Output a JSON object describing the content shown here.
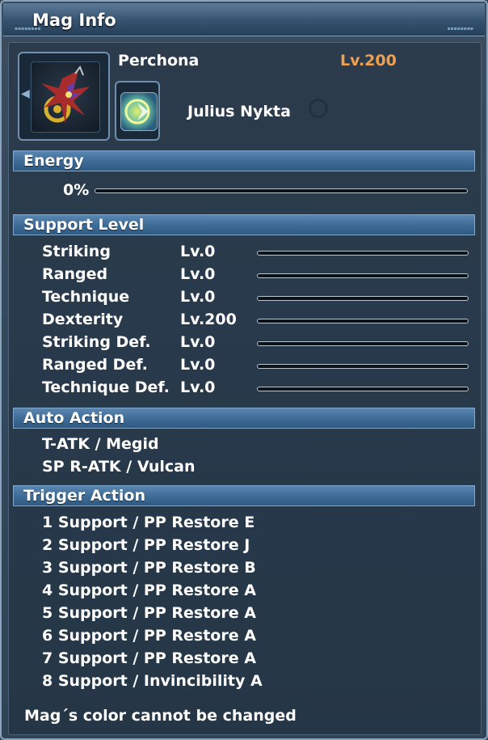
{
  "window": {
    "title": "Mag Info"
  },
  "mag": {
    "name": "Perchona",
    "level": "Lv.200",
    "owner": "Julius Nykta"
  },
  "energy": {
    "header": "Energy",
    "value": "0%",
    "fill_percent": 0
  },
  "support": {
    "header": "Support Level",
    "stats": [
      {
        "name": "Striking",
        "level": "Lv.0",
        "fill_percent": 0
      },
      {
        "name": "Ranged",
        "level": "Lv.0",
        "fill_percent": 0
      },
      {
        "name": "Technique",
        "level": "Lv.0",
        "fill_percent": 0
      },
      {
        "name": "Dexterity",
        "level": "Lv.200",
        "fill_percent": 0
      },
      {
        "name": "Striking Def.",
        "level": "Lv.0",
        "fill_percent": 0
      },
      {
        "name": "Ranged Def.",
        "level": "Lv.0",
        "fill_percent": 0
      },
      {
        "name": "Technique Def.",
        "level": "Lv.0",
        "fill_percent": 0
      }
    ]
  },
  "auto_action": {
    "header": "Auto Action",
    "items": [
      "T-ATK / Megid",
      "SP R-ATK / Vulcan"
    ]
  },
  "trigger_action": {
    "header": "Trigger Action",
    "items": [
      "1 Support / PP Restore E",
      "2 Support / PP Restore J",
      "3 Support / PP Restore B",
      "4 Support / PP Restore A",
      "5 Support / PP Restore A",
      "6 Support / PP Restore A",
      "7 Support / PP Restore A",
      "8 Support / Invincibility A"
    ]
  },
  "footer": {
    "text": "Mag´s color cannot be changed"
  },
  "colors": {
    "level_accent": "#f0a050",
    "section_header": "#3f6d98"
  },
  "icons": {
    "mag_portrait": "mag-portrait-icon",
    "owner_badge": "owner-badge-icon"
  }
}
